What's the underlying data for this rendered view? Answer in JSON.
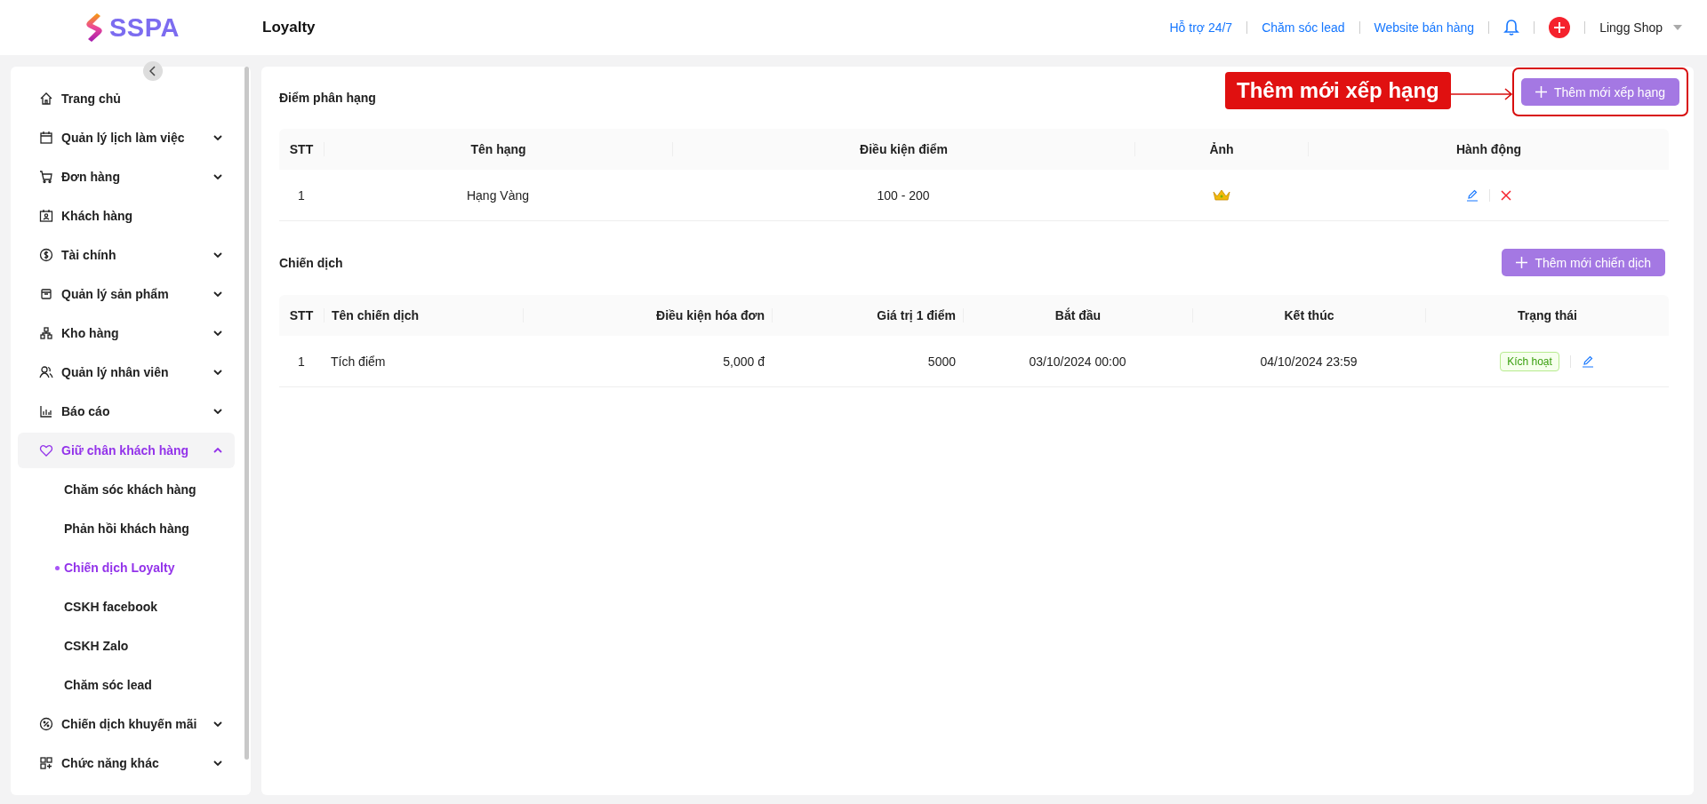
{
  "header": {
    "logo_text": "SSPA",
    "page_title": "Loyalty",
    "links": [
      "Hỗ trợ 24/7",
      "Chăm sóc lead",
      "Website bán hàng"
    ],
    "user": "Lingg Shop"
  },
  "sidebar": {
    "items": [
      {
        "label": "Trang chủ",
        "expandable": false,
        "selected": false
      },
      {
        "label": "Quản lý lịch làm việc",
        "expandable": true,
        "expanded": false,
        "selected": false
      },
      {
        "label": "Đơn hàng",
        "expandable": true,
        "expanded": false,
        "selected": false
      },
      {
        "label": "Khách hàng",
        "expandable": false,
        "selected": false
      },
      {
        "label": "Tài chính",
        "expandable": true,
        "expanded": false,
        "selected": false
      },
      {
        "label": "Quản lý sản phẩm",
        "expandable": true,
        "expanded": false,
        "selected": false
      },
      {
        "label": "Kho hàng",
        "expandable": true,
        "expanded": false,
        "selected": false
      },
      {
        "label": "Quản lý nhân viên",
        "expandable": true,
        "expanded": false,
        "selected": false
      },
      {
        "label": "Báo cáo",
        "expandable": true,
        "expanded": false,
        "selected": false
      },
      {
        "label": "Giữ chân khách hàng",
        "expandable": true,
        "expanded": true,
        "selected": true,
        "children": [
          {
            "label": "Chăm sóc khách hàng",
            "selected": false
          },
          {
            "label": "Phản hồi khách hàng",
            "selected": false
          },
          {
            "label": "Chiến dịch Loyalty",
            "selected": true
          },
          {
            "label": "CSKH facebook",
            "selected": false
          },
          {
            "label": "CSKH Zalo",
            "selected": false
          },
          {
            "label": "Chăm sóc lead",
            "selected": false
          }
        ]
      },
      {
        "label": "Chiến dịch khuyến mãi",
        "expandable": true,
        "expanded": false,
        "selected": false
      },
      {
        "label": "Chức năng khác",
        "expandable": true,
        "expanded": false,
        "selected": false
      }
    ]
  },
  "rank_section": {
    "title": "Điểm phân hạng",
    "add_button": "Thêm mới xếp hạng",
    "columns": [
      "STT",
      "Tên hạng",
      "Điều kiện điểm",
      "Ảnh",
      "Hành động"
    ],
    "rows": [
      {
        "stt": "1",
        "name": "Hạng Vàng",
        "condition": "100 - 200"
      }
    ]
  },
  "annotation": {
    "label": "Thêm mới xếp hạng"
  },
  "campaign_section": {
    "title": "Chiến dịch",
    "add_button": "Thêm mới chiến dịch",
    "columns": [
      "STT",
      "Tên chiến dịch",
      "Điều kiện hóa đơn",
      "Giá trị 1 điểm",
      "Bắt đầu",
      "Kết thúc",
      "Trạng thái"
    ],
    "rows": [
      {
        "stt": "1",
        "name": "Tích điểm",
        "invoice_condition": "5,000 đ",
        "point_value": "5000",
        "start": "03/10/2024 00:00",
        "end": "04/10/2024 23:59",
        "status": "Kích hoạt"
      }
    ]
  }
}
